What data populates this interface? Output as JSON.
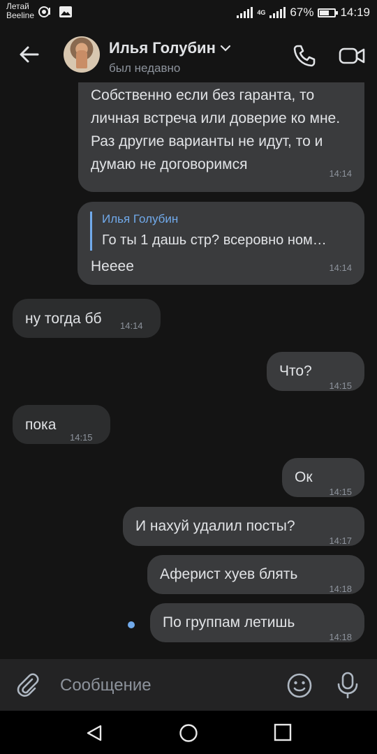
{
  "status_bar": {
    "carrier_line1": "Летай",
    "carrier_line2": "Beeline",
    "network": "4G",
    "battery": "67%",
    "battery_level": 0.67,
    "time": "14:19"
  },
  "header": {
    "name": "Илья Голубин",
    "status": "был недавно"
  },
  "messages": [
    {
      "direction": "out",
      "text": "Собственно если без гаранта, то личная встреча или доверие ко мне. Раз другие варианты не идут, то и думаю не договоримся",
      "time": "14:14"
    },
    {
      "direction": "out",
      "reply_to_name": "Илья Голубин",
      "reply_to_text": "Го ты 1 дашь стр? всеровно ном…",
      "text": "Нееее",
      "time": "14:14"
    },
    {
      "direction": "in",
      "text": "ну тогда бб",
      "time": "14:14"
    },
    {
      "direction": "out",
      "text": "Что?",
      "time": "14:15"
    },
    {
      "direction": "in",
      "text": "пока",
      "time": "14:15"
    },
    {
      "direction": "out",
      "text": "Ок",
      "time": "14:15"
    },
    {
      "direction": "out",
      "text": "И нахуй удалил посты?",
      "time": "14:17"
    },
    {
      "direction": "out",
      "text": "Аферист хуев блять",
      "time": "14:18"
    },
    {
      "direction": "out",
      "text": "По группам летишь",
      "time": "14:18",
      "unread": true
    }
  ],
  "input": {
    "placeholder": "Сообщение"
  },
  "colors": {
    "background": "#141414",
    "bubble_out": "#3a3b3d",
    "bubble_in": "#2c2d2e",
    "accent": "#71aaeb",
    "secondary_text": "#8d939c"
  },
  "icons": [
    "back-arrow-icon",
    "chevron-down-icon",
    "phone-icon",
    "video-camera-icon",
    "paperclip-icon",
    "smile-icon",
    "microphone-icon",
    "nav-back-icon",
    "nav-home-icon",
    "nav-recent-icon"
  ]
}
